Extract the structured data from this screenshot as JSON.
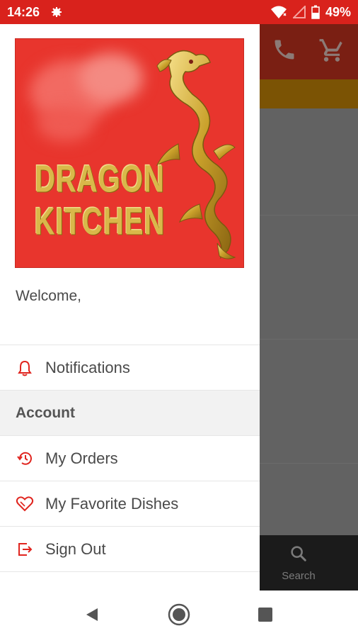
{
  "status_bar": {
    "time": "14:26",
    "battery": "49%",
    "icons": [
      "notification-icon",
      "wifi-icon",
      "signal-icon",
      "battery-icon"
    ]
  },
  "background_app": {
    "header_icons": [
      "phone-icon",
      "cart-icon"
    ],
    "bottom_nav": {
      "search_label": "Search",
      "icon": "search-icon"
    },
    "colors": {
      "header": "#7a1f13",
      "strip": "#7b5304",
      "overlay": "#626262"
    }
  },
  "drawer": {
    "logo": {
      "line1": "DRAGON",
      "line2": "KITCHEN",
      "background": "#e8352d",
      "gold": "#d9b84a"
    },
    "welcome": "Welcome,",
    "menu": {
      "notifications": {
        "label": "Notifications",
        "icon": "bell-icon"
      },
      "account_header": "Account",
      "my_orders": {
        "label": "My Orders",
        "icon": "history-icon"
      },
      "favorites": {
        "label": "My Favorite Dishes",
        "icon": "heart-icon"
      },
      "sign_out": {
        "label": "Sign Out",
        "icon": "exit-icon"
      }
    },
    "accent": "#e0251f"
  },
  "system_nav": [
    "back-icon",
    "home-icon",
    "recents-icon"
  ]
}
